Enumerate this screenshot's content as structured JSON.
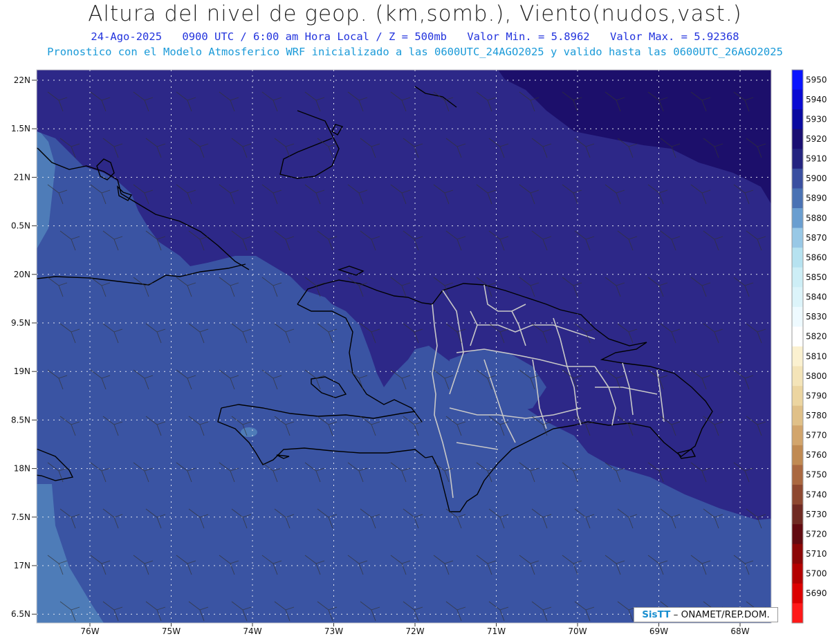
{
  "header": {
    "title": "Altura del nivel de geop. (km,somb.), Viento(nudos,vast.)",
    "date": "24-Ago-2025",
    "time": "0900 UTC / 6:00 am Hora Local / Z = 500mb",
    "min_label": "Valor Min. = 5.8962",
    "max_label": "Valor Max. = 5.92368",
    "model_info": "Pronostico con el Modelo Atmosferico WRF inicializado a las 0600UTC_24AGO2025 y valido hasta las  0600UTC_26AGO2025"
  },
  "axes": {
    "y_labels": [
      "22N",
      "1.5N",
      "21N",
      "0.5N",
      "20N",
      "9.5N",
      "19N",
      "8.5N",
      "18N",
      "7.5N",
      "17N",
      "6.5N"
    ],
    "x_labels": [
      "76W",
      "75W",
      "74W",
      "73W",
      "72W",
      "71W",
      "70W",
      "69W",
      "68W"
    ]
  },
  "colorbar": {
    "levels": [
      "5950",
      "5940",
      "5930",
      "5920",
      "5910",
      "5900",
      "5890",
      "5880",
      "5870",
      "5860",
      "5850",
      "5840",
      "5830",
      "5820",
      "5810",
      "5800",
      "5790",
      "5780",
      "5770",
      "5760",
      "5750",
      "5740",
      "5730",
      "5720",
      "5710",
      "5700",
      "5690"
    ],
    "colors": [
      "#0a14ff",
      "#0a0ad2",
      "#0a0aa0",
      "#1a0f72",
      "#242480",
      "#3a4fa0",
      "#4a72b4",
      "#6a9ed0",
      "#98c8e6",
      "#b6e2f0",
      "#cdeef6",
      "#dcf4fa",
      "#eefaff",
      "#ffffff",
      "#fbf1d0",
      "#f4e4b8",
      "#ecd5a0",
      "#e0c088",
      "#d2a56c",
      "#c08a52",
      "#aa6840",
      "#8e4830",
      "#702a22",
      "#620a10",
      "#8c0606",
      "#b40000",
      "#dc0000",
      "#ff1818"
    ]
  },
  "map": {
    "colors": {
      "band_5920": "#1c0f6b",
      "band_5910": "#2d2888",
      "band_5900": "#3a54a3",
      "band_5890": "#4e7cb8",
      "grid": "#e0e4f0",
      "coast": "#000000",
      "border": "#c8c8c8"
    }
  },
  "credit": {
    "logo": "SisTT",
    "text": "– ONAMET/REP.DOM."
  }
}
